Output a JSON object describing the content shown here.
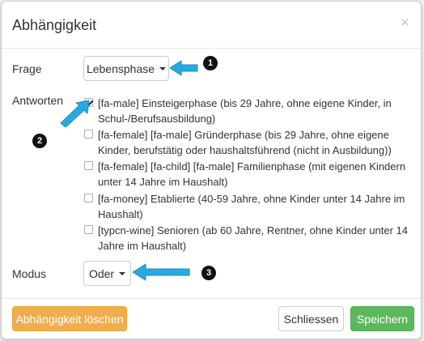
{
  "modal": {
    "title": "Abhängigkeit",
    "close_symbol": "×"
  },
  "frage": {
    "label": "Frage",
    "value": "Lebensphase"
  },
  "antworten": {
    "label": "Antworten",
    "options": [
      {
        "text": "[fa-male] Einsteigerphase (bis 29 Jahre, ohne eigene Kinder, in Schul-/Berufsausbildung)",
        "checked": true
      },
      {
        "text": "[fa-female] [fa-male] Gründerphase (bis 29 Jahre, ohne eigene Kinder, berufstätig oder haushaltsführend (nicht in Ausbildung))",
        "checked": false
      },
      {
        "text": "[fa-female] [fa-child] [fa-male] Familienphase (mit eigenen Kindern unter 14 Jahre im Haushalt)",
        "checked": false
      },
      {
        "text": "[fa-money] Etablierte (40-59 Jahre, ohne Kinder unter 14 Jahre im Haushalt)",
        "checked": false
      },
      {
        "text": "[typcn-wine] Senioren (ab 60 Jahre, Rentner, ohne Kinder unter 14 Jahre im Haushalt)",
        "checked": false
      }
    ]
  },
  "modus": {
    "label": "Modus",
    "value": "Oder"
  },
  "footer": {
    "delete_label": "Abhängigkeit löschen",
    "close_label": "Schliessen",
    "save_label": "Speichern"
  },
  "annotations": {
    "badge_1": "1",
    "badge_2": "2",
    "badge_3": "3"
  },
  "colors": {
    "delete_button": "#f0ad4e",
    "save_button": "#5cb85c",
    "arrow": "#29a9e0",
    "badge": "#111111"
  },
  "icons": [
    "close-icon",
    "caret-down-icon",
    "checkbox-checked",
    "checkbox-unchecked",
    "arrow-annotation"
  ]
}
